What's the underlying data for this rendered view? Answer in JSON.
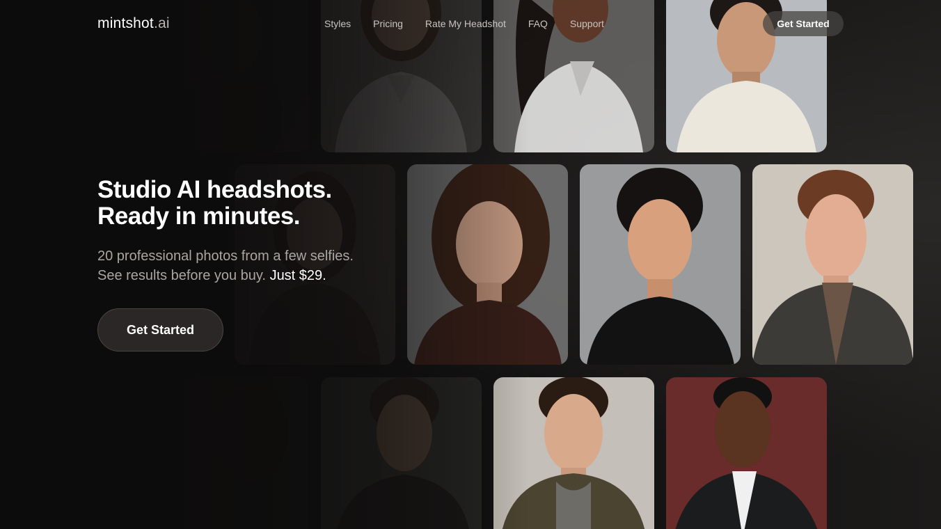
{
  "nav": {
    "logo_main": "mintshot",
    "logo_tld": ".ai",
    "links": [
      "Styles",
      "Pricing",
      "Rate My Headshot",
      "FAQ",
      "Support"
    ],
    "cta_label": "Get Started"
  },
  "hero": {
    "title_line1": "Studio AI headshots.",
    "title_line2": "Ready in minutes.",
    "subtitle_line1": "20 professional photos from a few selfies.",
    "subtitle_line2_pre": "See results before you buy.",
    "subtitle_line2_price": "Just $29.",
    "cta_label": "Get Started"
  },
  "colors": {
    "background": "#0d0c0c",
    "button_bg": "#2a2726"
  }
}
